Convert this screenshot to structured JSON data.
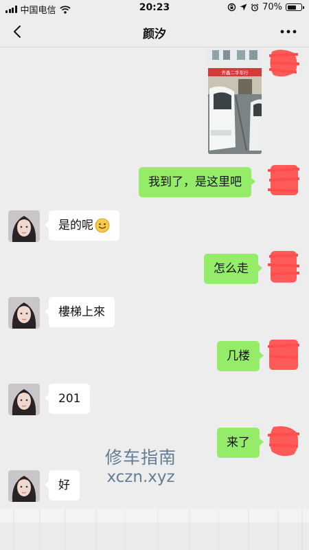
{
  "status_bar": {
    "carrier": "中国电信",
    "time": "20:23",
    "battery_text": "70%",
    "battery_level": 0.7,
    "icons": [
      "signal-bars-icon",
      "wifi-icon",
      "rotation-lock-icon",
      "location-arrow-icon",
      "alarm-icon",
      "battery-icon"
    ]
  },
  "nav": {
    "title": "颜汐",
    "back_icon": "chevron-left-icon",
    "more_icon": "more-dots-icon"
  },
  "messages": [
    {
      "sender": "me",
      "type": "image",
      "sign_text": "齐鑫二手车行"
    },
    {
      "sender": "me",
      "type": "text",
      "text": "我到了，是这里吧"
    },
    {
      "sender": "peer",
      "type": "text",
      "text": "是的呢",
      "emoji": "smile-emoji"
    },
    {
      "sender": "me",
      "type": "text",
      "text": "怎么走"
    },
    {
      "sender": "peer",
      "type": "text",
      "text": "樓梯上來"
    },
    {
      "sender": "me",
      "type": "text",
      "text": "几楼"
    },
    {
      "sender": "peer",
      "type": "text",
      "text": "201"
    },
    {
      "sender": "me",
      "type": "text",
      "text": "来了"
    },
    {
      "sender": "peer",
      "type": "text",
      "text": "好"
    }
  ],
  "watermark": {
    "line1": "修车指南",
    "line2": "xczn.xyz"
  },
  "colors": {
    "background": "#ededed",
    "self_bubble": "#95ec69",
    "peer_bubble": "#ffffff",
    "redaction": "#ff5a5a"
  }
}
